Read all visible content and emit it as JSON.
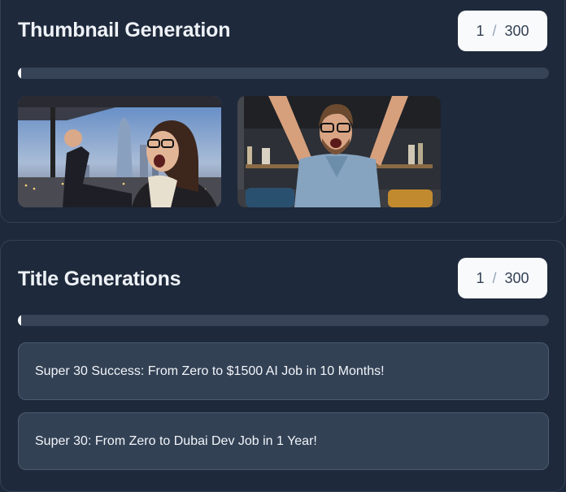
{
  "thumbnail_section": {
    "title": "Thumbnail Generation",
    "counter": {
      "current": "1",
      "separator": "/",
      "total": "300"
    },
    "progress_fraction": 0.0033,
    "thumbnails": [
      {
        "scene": "woman-celebrating-city-skyline"
      },
      {
        "scene": "man-celebrating-arms-raised"
      }
    ]
  },
  "titles_section": {
    "title": "Title Generations",
    "counter": {
      "current": "1",
      "separator": "/",
      "total": "300"
    },
    "progress_fraction": 0.0033,
    "titles": [
      "Super 30 Success: From Zero to $1500 AI Job in 10 Months!",
      "Super 30: From Zero to Dubai Dev Job in 1 Year!"
    ]
  }
}
